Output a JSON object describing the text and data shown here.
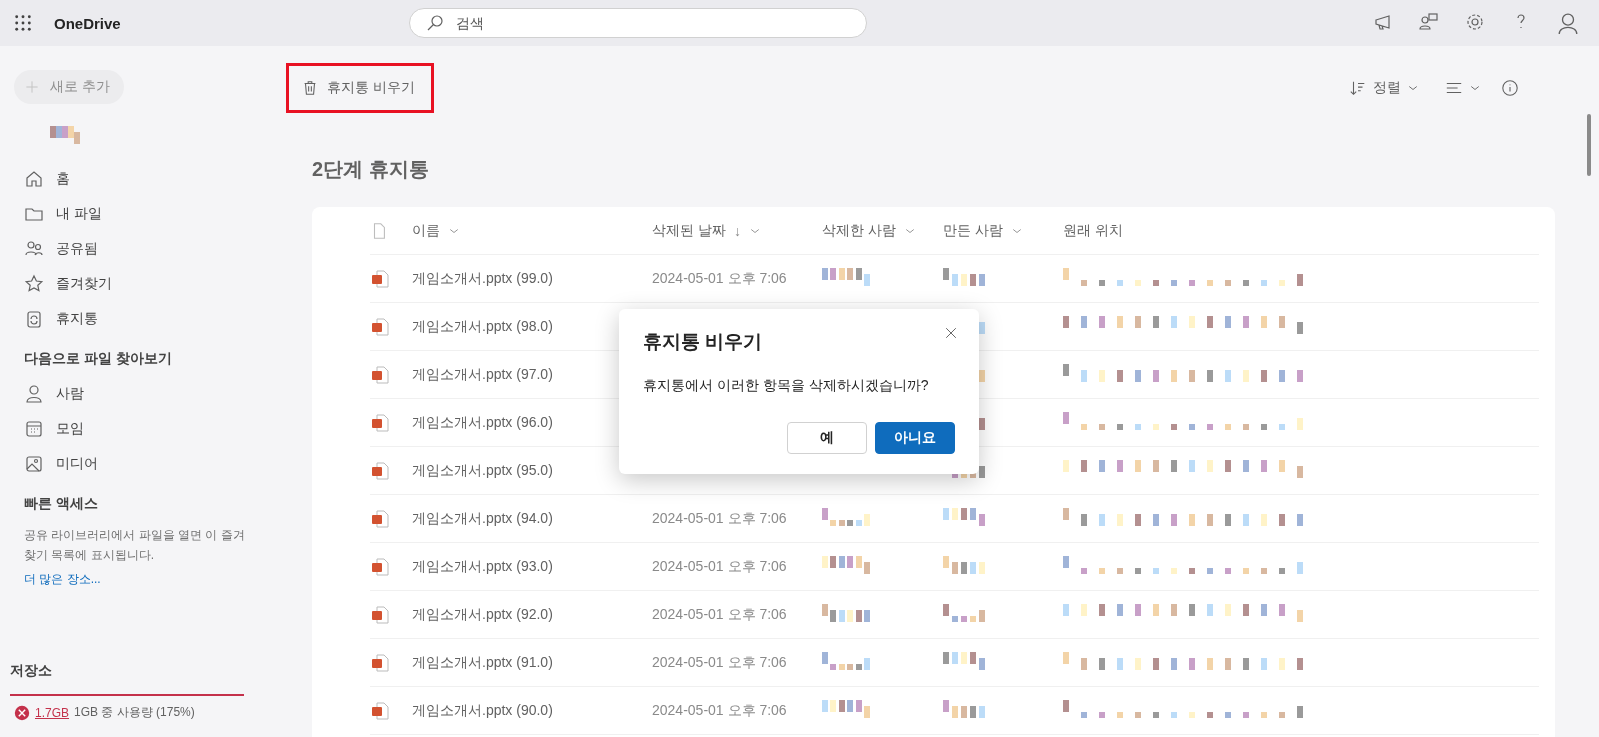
{
  "app": {
    "name": "OneDrive"
  },
  "search": {
    "placeholder": "검색"
  },
  "sidebar": {
    "new_button": "새로 추가",
    "nav": [
      {
        "label": "홈"
      },
      {
        "label": "내 파일"
      },
      {
        "label": "공유됨"
      },
      {
        "label": "즐겨찾기"
      },
      {
        "label": "휴지통"
      }
    ],
    "browse_heading": "다음으로 파일 찾아보기",
    "browse": [
      {
        "label": "사람"
      },
      {
        "label": "모임"
      },
      {
        "label": "미디어"
      }
    ],
    "quick_access": {
      "heading": "빠른 액세스",
      "text": "공유 라이브러리에서 파일을 열면 이 즐겨찾기 목록에 표시됩니다.",
      "link": "더 많은 장소..."
    },
    "storage": {
      "heading": "저장소",
      "used": "1.7GB",
      "detail": "1GB 중 사용량 (175%)",
      "level": 1
    }
  },
  "toolbar": {
    "empty_button": "휴지통 비우기",
    "highlighted": true,
    "sort": "정렬"
  },
  "heading": "2단계 휴지통",
  "table": {
    "columns": [
      {
        "label": "이름",
        "menu": true
      },
      {
        "label": "삭제된 날짜",
        "sort_mark": "↓",
        "menu": true
      },
      {
        "label": "삭제한 사람",
        "menu": true
      },
      {
        "label": "만든 사람",
        "menu": true
      },
      {
        "label": "원래 위치",
        "menu": false
      }
    ],
    "rows": [
      {
        "name": "게임소개서.pptx (99.0)",
        "deleted": "2024-05-01 오후 7:06"
      },
      {
        "name": "게임소개서.pptx (98.0)"
      },
      {
        "name": "게임소개서.pptx (97.0)"
      },
      {
        "name": "게임소개서.pptx (96.0)"
      },
      {
        "name": "게임소개서.pptx (95.0)"
      },
      {
        "name": "게임소개서.pptx (94.0)",
        "deleted": "2024-05-01 오후 7:06"
      },
      {
        "name": "게임소개서.pptx (93.0)",
        "deleted": "2024-05-01 오후 7:06"
      },
      {
        "name": "게임소개서.pptx (92.0)",
        "deleted": "2024-05-01 오후 7:06"
      },
      {
        "name": "게임소개서.pptx (91.0)",
        "deleted": "2024-05-01 오후 7:06"
      },
      {
        "name": "게임소개서.pptx (90.0)",
        "deleted": "2024-05-01 오후 7:06"
      }
    ]
  },
  "dialog": {
    "title": "휴지통 비우기",
    "message": "휴지통에서 이러한 항목을 삭제하시겠습니까?",
    "buttons": [
      {
        "label": "예",
        "primary": false
      },
      {
        "label": "아니요",
        "primary": true
      }
    ]
  }
}
